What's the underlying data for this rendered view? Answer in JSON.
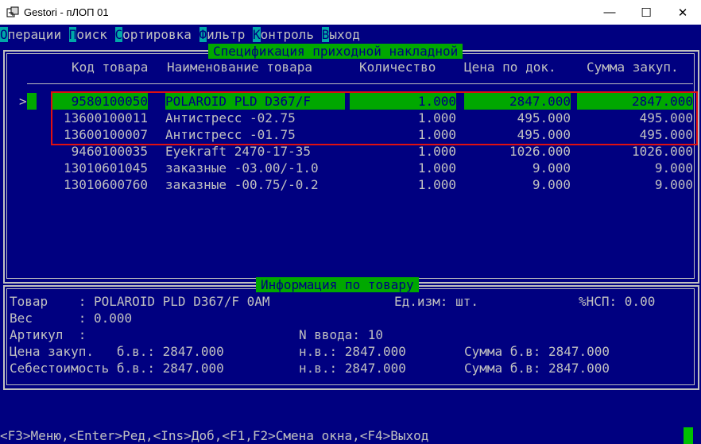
{
  "window": {
    "title": "Gestori - пЛОП 01",
    "minimize_glyph": "—",
    "maximize_glyph": "☐",
    "close_glyph": "✕",
    "icon": "gestori-app-icon"
  },
  "menu": [
    {
      "hot": "О",
      "rest": "перации"
    },
    {
      "hot": "П",
      "rest": "оиск"
    },
    {
      "hot": "С",
      "rest": "ортировка"
    },
    {
      "hot": "Ф",
      "rest": "ильтр"
    },
    {
      "hot": "К",
      "rest": "онтроль"
    },
    {
      "hot": "В",
      "rest": "ыход"
    }
  ],
  "spec_panel": {
    "title": "Спецификация приходной накладной",
    "columns": {
      "code": "Код товара",
      "name": "Наименование товара",
      "qty": "Количество",
      "price": "Цена по док.",
      "sum": "Сумма закуп."
    },
    "pointer": ">",
    "rows": [
      {
        "code": "9580100050",
        "name": "POLAROID PLD D367/F",
        "qty": "1.000",
        "price": "2847.000",
        "sum": "2847.000",
        "selected": true
      },
      {
        "code": "13600100011",
        "name": "Антистресс -02.75",
        "qty": "1.000",
        "price": "495.000",
        "sum": "495.000"
      },
      {
        "code": "13600100007",
        "name": "Антистресс -01.75",
        "qty": "1.000",
        "price": "495.000",
        "sum": "495.000"
      },
      {
        "code": "9460100035",
        "name": "Eyekraft 2470-17-35",
        "qty": "1.000",
        "price": "1026.000",
        "sum": "1026.000"
      },
      {
        "code": "13010601045",
        "name": "заказные -03.00/-1.0",
        "qty": "1.000",
        "price": "9.000",
        "sum": "9.000"
      },
      {
        "code": "13010600760",
        "name": "заказные -00.75/-0.2",
        "qty": "1.000",
        "price": "9.000",
        "sum": "9.000"
      }
    ]
  },
  "info_panel": {
    "title": "Информация по товару",
    "line1": {
      "product": "Товар    : POLAROID PLD D367/F 0AM",
      "unit": "Ед.изм: шт.",
      "nsp": "%НСП: 0.00"
    },
    "line2": {
      "weight": "Вес      : 0.000"
    },
    "line3": {
      "article": "Артикул  :",
      "entry": "N ввода: 10"
    },
    "line4": {
      "price_bv": "Цена закуп.   б.в.: 2847.000",
      "price_nv": "н.в.: 2847.000",
      "sum_bv": "Сумма б.в: 2847.000"
    },
    "line5": {
      "cost_bv": "Себестоимость б.в.: 2847.000",
      "cost_nv": "н.в.: 2847.000",
      "sum_bv": "Сумма б.в: 2847.000"
    }
  },
  "statusbar": {
    "text": "<F3>Меню,<Enter>Ред,<Ins>Доб,<F1,F2>Смена окна,<F4>Выход"
  },
  "colors": {
    "background": "#000080",
    "text": "#c0c0c0",
    "highlight": "#00a800",
    "menu_hotkey": "#00a8a8",
    "annotation_box": "#e01010"
  }
}
